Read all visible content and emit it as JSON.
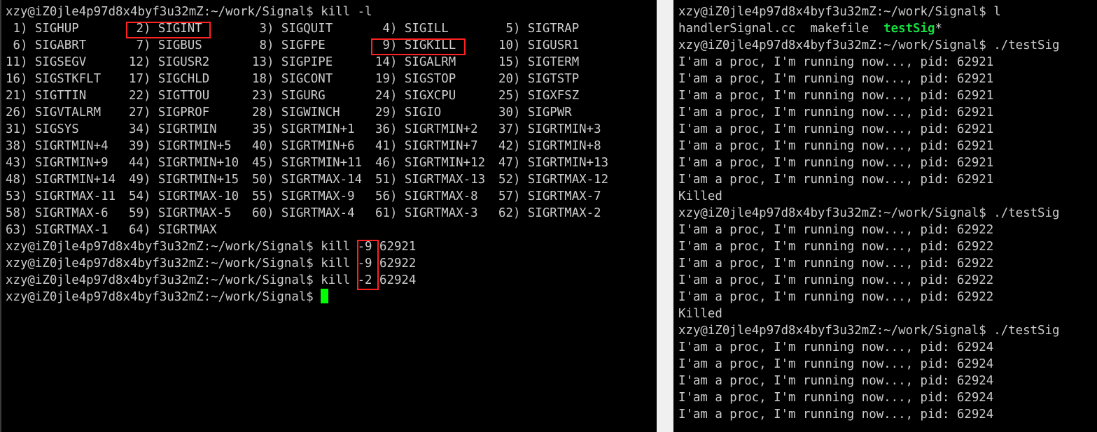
{
  "left_terminal": {
    "prompt": "xzy@iZ0jle4p97d8x4byf3u32mZ:~/work/Signal$ ",
    "command": "kill -l",
    "signal_rows": [
      [
        " 1) SIGHUP",
        " 2) SIGINT",
        " 3) SIGQUIT",
        " 4) SIGILL",
        " 5) SIGTRAP"
      ],
      [
        " 6) SIGABRT",
        " 7) SIGBUS",
        " 8) SIGFPE",
        " 9) SIGKILL",
        "10) SIGUSR1"
      ],
      [
        "11) SIGSEGV",
        "12) SIGUSR2",
        "13) SIGPIPE",
        "14) SIGALRM",
        "15) SIGTERM"
      ],
      [
        "16) SIGSTKFLT",
        "17) SIGCHLD",
        "18) SIGCONT",
        "19) SIGSTOP",
        "20) SIGTSTP"
      ],
      [
        "21) SIGTTIN",
        "22) SIGTTOU",
        "23) SIGURG",
        "24) SIGXCPU",
        "25) SIGXFSZ"
      ],
      [
        "26) SIGVTALRM",
        "27) SIGPROF",
        "28) SIGWINCH",
        "29) SIGIO",
        "30) SIGPWR"
      ],
      [
        "31) SIGSYS",
        "34) SIGRTMIN",
        "35) SIGRTMIN+1",
        "36) SIGRTMIN+2",
        "37) SIGRTMIN+3"
      ],
      [
        "38) SIGRTMIN+4",
        "39) SIGRTMIN+5",
        "40) SIGRTMIN+6",
        "41) SIGRTMIN+7",
        "42) SIGRTMIN+8"
      ],
      [
        "43) SIGRTMIN+9",
        "44) SIGRTMIN+10",
        "45) SIGRTMIN+11",
        "46) SIGRTMIN+12",
        "47) SIGRTMIN+13"
      ],
      [
        "48) SIGRTMIN+14",
        "49) SIGRTMIN+15",
        "50) SIGRTMAX-14",
        "51) SIGRTMAX-13",
        "52) SIGRTMAX-12"
      ],
      [
        "53) SIGRTMAX-11",
        "54) SIGRTMAX-10",
        "55) SIGRTMAX-9",
        "56) SIGRTMAX-8",
        "57) SIGRTMAX-7"
      ],
      [
        "58) SIGRTMAX-6",
        "59) SIGRTMAX-5",
        "60) SIGRTMAX-4",
        "61) SIGRTMAX-3",
        "62) SIGRTMAX-2"
      ],
      [
        "63) SIGRTMAX-1",
        "64) SIGRTMAX"
      ]
    ],
    "kill_commands": [
      {
        "cmd": "kill ",
        "flag": "-9",
        "pid": " 62921"
      },
      {
        "cmd": "kill ",
        "flag": "-9",
        "pid": " 62922"
      },
      {
        "cmd": "kill ",
        "flag": "-2",
        "pid": " 62924"
      }
    ]
  },
  "right_terminal": {
    "prompt": "xzy@iZ0jle4p97d8x4byf3u32mZ:~/work/Signal$ ",
    "ls_command": "l",
    "files_plain": "handlerSignal.cc  makefile  ",
    "file_exec": "testSig",
    "file_exec_suffix": "*",
    "run_command": "./testSig",
    "running_msg": "I'am a proc, I'm running now..., pid: ",
    "killed_text": "Killed",
    "runs": [
      {
        "pid": "62921",
        "count": 8,
        "killed": true
      },
      {
        "pid": "62922",
        "count": 5,
        "killed": true
      },
      {
        "pid": "62924",
        "count": 5,
        "killed": false
      }
    ]
  },
  "colors": {
    "background": "#000000",
    "text": "#cccccc",
    "executable": "#13e03e",
    "cursor": "#00ff00",
    "highlight_box": "#ff2222"
  }
}
